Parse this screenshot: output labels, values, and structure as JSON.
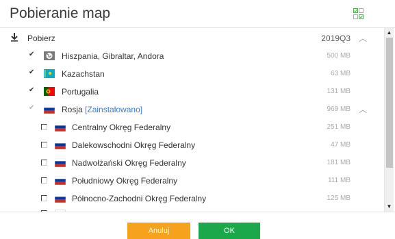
{
  "header": {
    "title": "Pobieranie map",
    "select_icon": "checklist-icon"
  },
  "download_row": {
    "icon": "download-icon",
    "label": "Pobierz",
    "version": "2019Q3",
    "chevron": "^"
  },
  "items": [
    {
      "label": "Hiszpania, Gibraltar, Andora",
      "size": "500 MB",
      "checked": true,
      "flag": "globe"
    },
    {
      "label": "Kazachstan",
      "size": "63 MB",
      "checked": true,
      "flag": "kazakhstan"
    },
    {
      "label": "Portugalia",
      "size": "131 MB",
      "checked": true,
      "flag": "portugal"
    },
    {
      "label": "Rosja",
      "installed": "[Zainstalowano]",
      "size": "969 MB",
      "checked": "grey",
      "flag": "russia",
      "chevron": "^"
    }
  ],
  "sub_items": [
    {
      "label": "Centralny Okręg Federalny",
      "size": "251 MB"
    },
    {
      "label": "Dalekowschodni Okręg Federalny",
      "size": "47 MB"
    },
    {
      "label": "Nadwołżański Okręg Federalny",
      "size": "181 MB"
    },
    {
      "label": "Południowy Okręg Federalny",
      "size": "111 MB"
    },
    {
      "label": "Północno-Zachodni Okręg Federalny",
      "size": "125 MB"
    }
  ],
  "buttons": {
    "cancel": "Anuluj",
    "ok": "OK"
  },
  "colors": {
    "cancel": "#f6a21c",
    "ok": "#1aa84a",
    "installed": "#3a7bd5"
  }
}
